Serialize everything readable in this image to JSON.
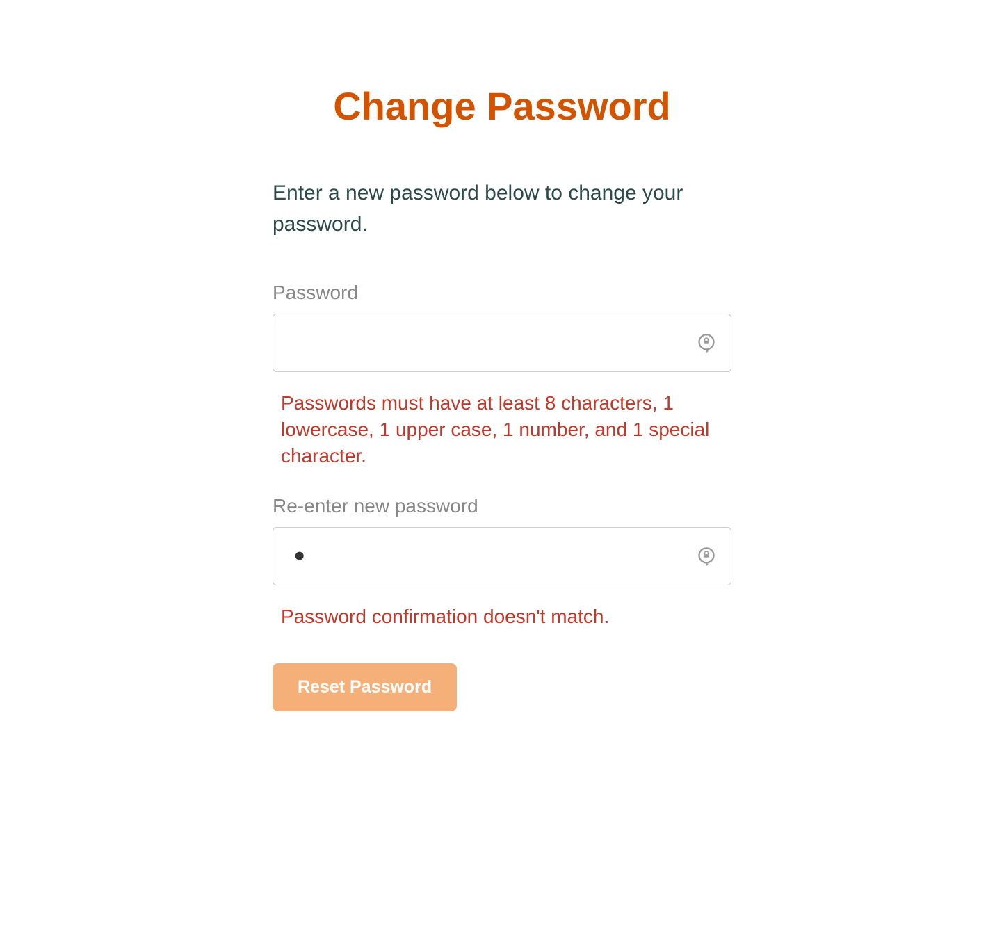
{
  "title": "Change Password",
  "instruction": "Enter a new password below to change your password.",
  "fields": {
    "password": {
      "label": "Password",
      "value": "",
      "error": "Passwords must have at least 8 characters, 1 lowercase, 1 upper case, 1 number, and 1 special character."
    },
    "confirm": {
      "label": "Re-enter new password",
      "value": "•",
      "error": "Password confirmation doesn't match."
    }
  },
  "button": {
    "label": "Reset Password"
  },
  "colors": {
    "accent": "#d35400",
    "error": "#c0392b",
    "label": "#888888",
    "instruction": "#2c4a4a",
    "button_bg": "#f5b07a"
  }
}
